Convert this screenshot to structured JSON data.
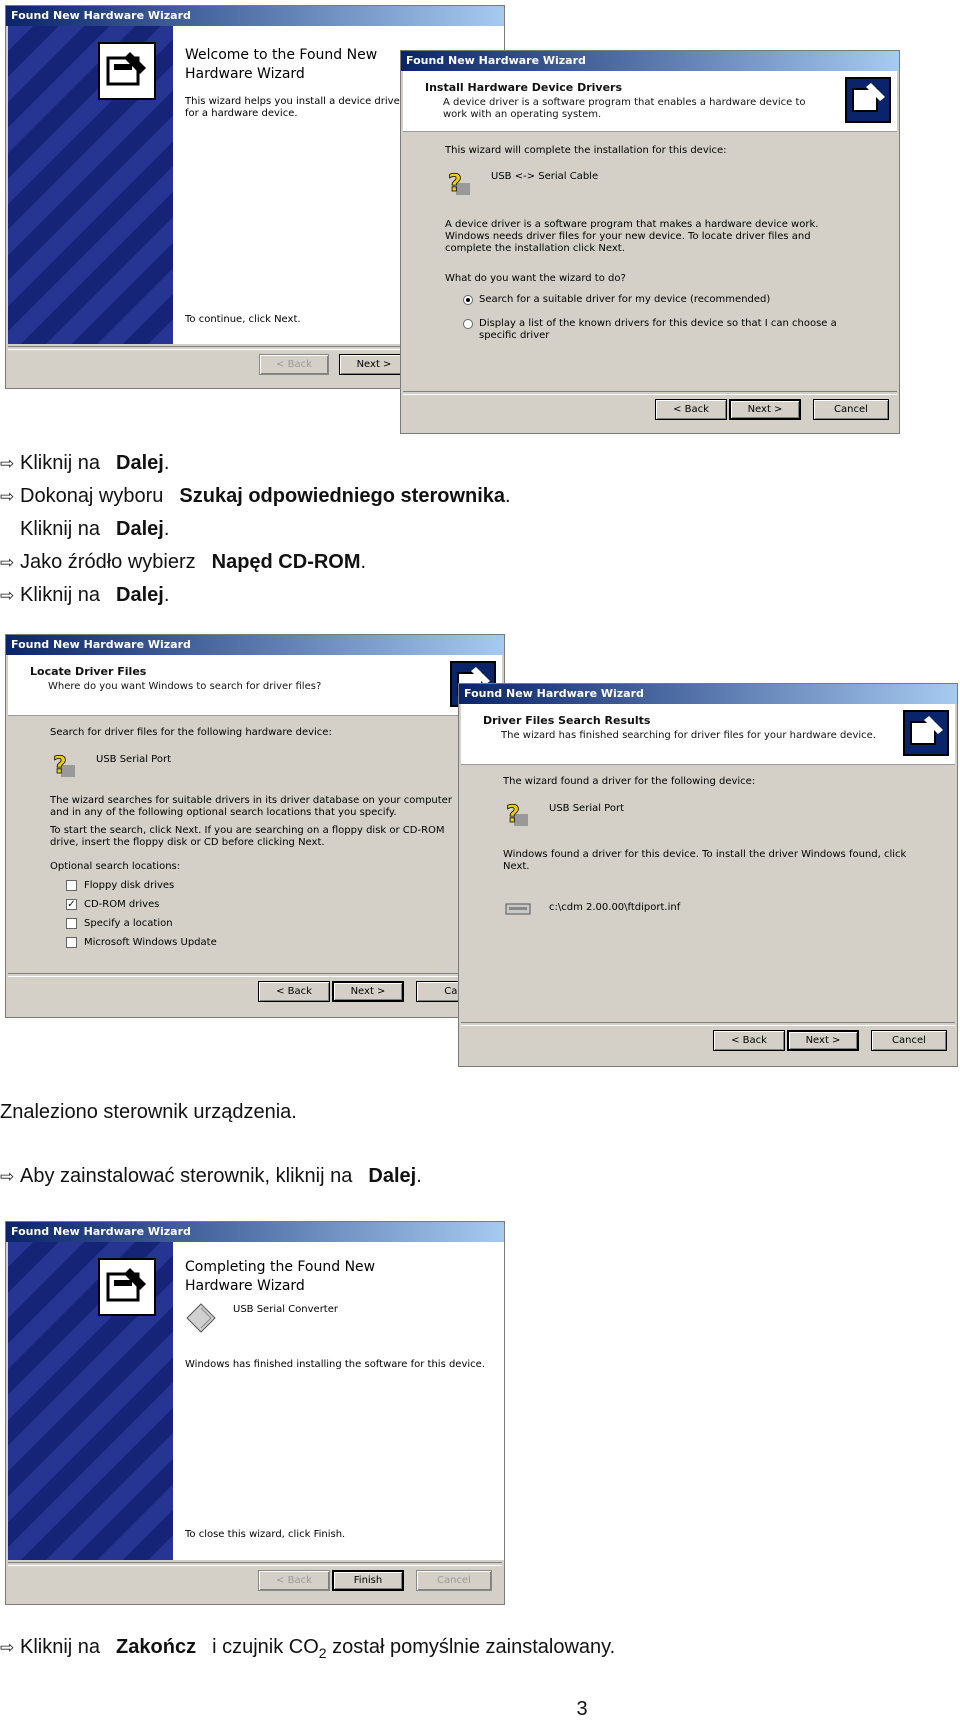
{
  "wiz1": {
    "title": "Found New Hardware Wizard",
    "heading": "Welcome to the Found New Hardware Wizard",
    "desc": "This wizard helps you install a device driver for a hardware device.",
    "footer": "To continue, click Next.",
    "back": "< Back",
    "next": "Next >"
  },
  "wiz2": {
    "title": "Found New Hardware Wizard",
    "header_title": "Install Hardware Device Drivers",
    "header_sub": "A device driver is a software program that enables a hardware device to work with an operating system.",
    "intro": "This wizard will complete the installation for this device:",
    "device": "USB <-> Serial Cable",
    "para": "A device driver is a software program that makes a hardware device work. Windows needs driver files for your new device. To locate driver files and complete the installation click Next.",
    "question": "What do you want the wizard to do?",
    "opt1": "Search for a suitable driver for my device (recommended)",
    "opt2": "Display a list of the known drivers for this device so that I can choose a specific driver",
    "back": "< Back",
    "next": "Next >",
    "cancel": "Cancel"
  },
  "instr1": {
    "l1a": "Kliknij na",
    "l1b": "Dalej",
    "l1c": ".",
    "l2a": "Dokonaj wyboru",
    "l2b": "Szukaj odpowiedniego sterownika",
    "l2c": ".",
    "l3a": "Kliknij na",
    "l3b": "Dalej",
    "l3c": ".",
    "l4a": "Jako źródło wybierz",
    "l4b": "Napęd CD-ROM",
    "l4c": ".",
    "l5a": "Kliknij na",
    "l5b": "Dalej",
    "l5c": "."
  },
  "wiz3": {
    "title": "Found New Hardware Wizard",
    "header_title": "Locate Driver Files",
    "header_sub": "Where do you want Windows to search for driver files?",
    "intro": "Search for driver files for the following hardware device:",
    "device": "USB Serial Port",
    "para1": "The wizard searches for suitable drivers in its driver database on your computer and in any of the following optional search locations that you specify.",
    "para2": "To start the search, click Next. If you are searching on a floppy disk or CD-ROM drive, insert the floppy disk or CD before clicking Next.",
    "optional": "Optional search locations:",
    "c1": "Floppy disk drives",
    "c2": "CD-ROM drives",
    "c3": "Specify a location",
    "c4": "Microsoft Windows Update",
    "back": "< Back",
    "next": "Next >",
    "cancel": "Can"
  },
  "wiz4": {
    "title": "Found New Hardware Wizard",
    "header_title": "Driver Files Search Results",
    "header_sub": "The wizard has finished searching for driver files for your hardware device.",
    "intro": "The wizard found a driver for the following device:",
    "device": "USB Serial Port",
    "para": "Windows found a driver for this device. To install the driver Windows found, click Next.",
    "path": "c:\\cdm 2.00.00\\ftdiport.inf",
    "back": "< Back",
    "next": "Next >",
    "cancel": "Cancel"
  },
  "found": "Znaleziono sterownik urządzenia.",
  "instr2": {
    "a": "Aby zainstalować sterownik, kliknij na",
    "b": "Dalej",
    "c": "."
  },
  "wiz5": {
    "title": "Found New Hardware Wizard",
    "heading": "Completing the Found New Hardware Wizard",
    "device": "USB Serial Converter",
    "msg": "Windows has finished installing the software for this device.",
    "footer": "To close this wizard, click Finish.",
    "back": "< Back",
    "finish": "Finish",
    "cancel": "Cancel"
  },
  "final": {
    "a": "Kliknij na",
    "b": "Zakończ",
    "c": "i czujnik CO",
    "sub": "2",
    "d": "został pomyślnie zainstalowany."
  },
  "page_number": "3"
}
